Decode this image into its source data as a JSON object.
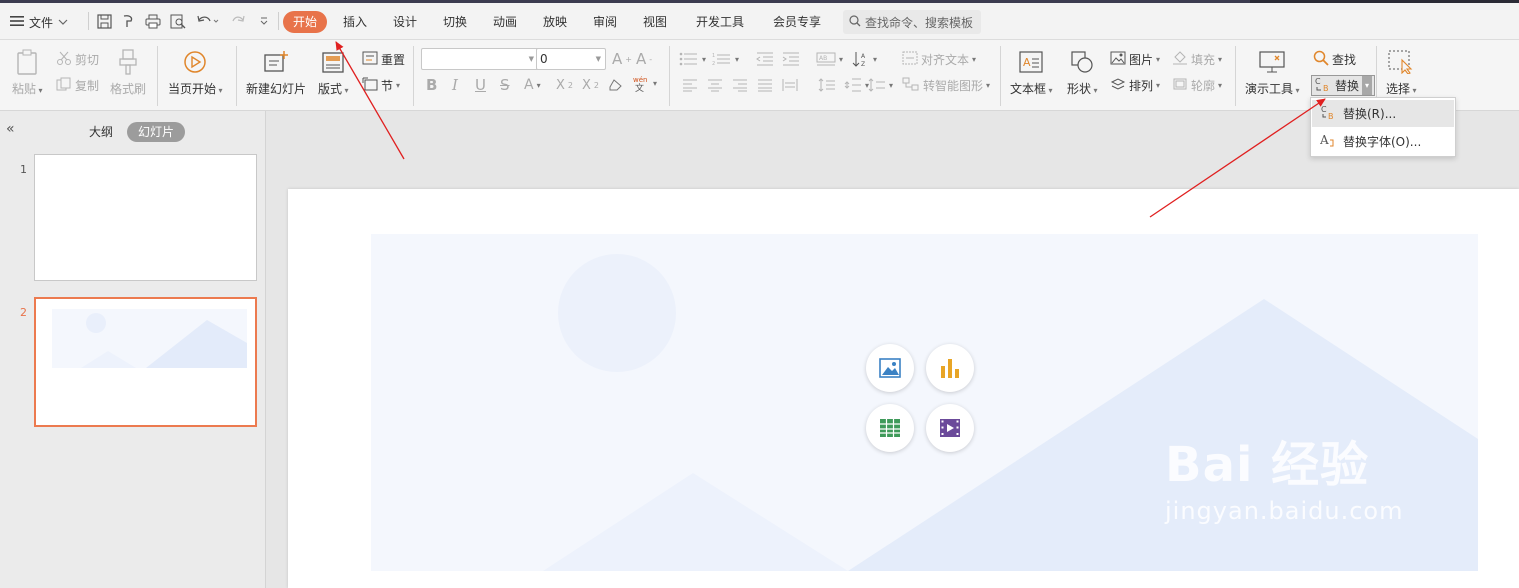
{
  "menu": {
    "file": "文件"
  },
  "tabs": [
    {
      "label": "开始",
      "active": true
    },
    {
      "label": "插入"
    },
    {
      "label": "设计"
    },
    {
      "label": "切换"
    },
    {
      "label": "动画"
    },
    {
      "label": "放映"
    },
    {
      "label": "审阅"
    },
    {
      "label": "视图"
    },
    {
      "label": "开发工具"
    },
    {
      "label": "会员专享"
    }
  ],
  "search": {
    "placeholder": "查找命令、搜索模板"
  },
  "ribbon": {
    "paste": "粘贴",
    "cut": "剪切",
    "copy": "复制",
    "format_painter": "格式刷",
    "play_from_current": "当页开始",
    "new_slide": "新建幻灯片",
    "layout": "版式",
    "reset": "重置",
    "section": "节",
    "font_name": "",
    "font_size": "0",
    "align_text": "对齐文本",
    "smart_art": "转智能图形",
    "textbox": "文本框",
    "shape": "形状",
    "picture": "图片",
    "arrange": "排列",
    "fill": "填充",
    "outline": "轮廓",
    "presentation_tools": "演示工具",
    "find": "查找",
    "replace": "替换",
    "select": "选择"
  },
  "replace_menu": {
    "replace": "替换(R)...",
    "replace_font": "替换字体(O)..."
  },
  "panel": {
    "outline_tab": "大纲",
    "slides_tab": "幻灯片",
    "slide_numbers": [
      "1",
      "2"
    ]
  },
  "watermark": {
    "title": "Bai 经验",
    "url": "jingyan.baidu.com"
  },
  "colors": {
    "accent": "#e8734a",
    "annotation": "#e02020",
    "placeholder_bg": "#f4f7fd",
    "placeholder_shape": "#e3ebfa"
  }
}
